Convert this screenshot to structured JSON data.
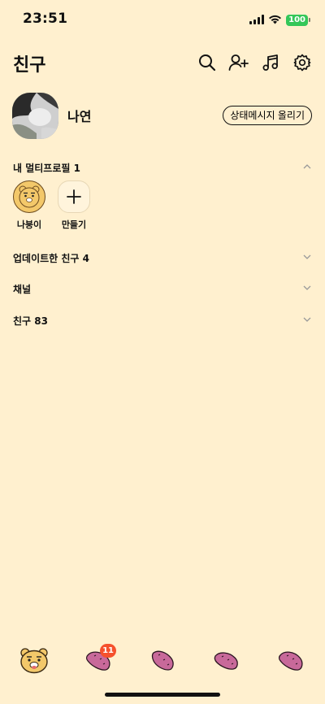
{
  "status_bar": {
    "time": "23:51",
    "battery": "100"
  },
  "header": {
    "title": "친구",
    "icons": [
      "search-icon",
      "add-friend-icon",
      "music-icon",
      "settings-icon"
    ]
  },
  "profile": {
    "name": "나연",
    "status_button": "상태메시지 올리기"
  },
  "sections": {
    "multi_profile": "내 멀티프로필 1",
    "updated_friends": "업데이트한 친구 4",
    "channels": "채널",
    "friends": "친구 83"
  },
  "multi_profiles": [
    {
      "label": "나붕이"
    },
    {
      "label": "만들기"
    }
  ],
  "bottom_nav": {
    "items": [
      "friends-tab",
      "chats-tab",
      "view-tab",
      "shopping-tab",
      "more-tab"
    ],
    "chats_badge": "11"
  },
  "colors": {
    "background": "#FFF0CF",
    "badge": "#F5512D",
    "sweet_potato": "#C8699A",
    "battery": "#34C759"
  }
}
